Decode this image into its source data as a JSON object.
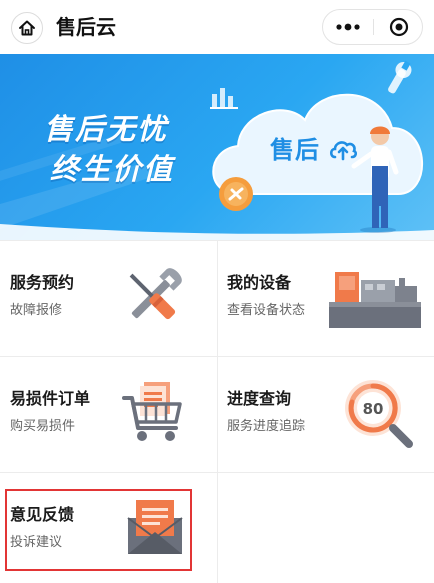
{
  "header": {
    "title": "售后云"
  },
  "banner": {
    "slogan_line1": "售后无忧",
    "slogan_line2": "终生价值",
    "cloud_brand": "售后"
  },
  "menu": [
    {
      "title": "服务预约",
      "subtitle": "故障报修",
      "icon": "tools-icon"
    },
    {
      "title": "我的设备",
      "subtitle": "查看设备状态",
      "icon": "machine-icon"
    },
    {
      "title": "易损件订单",
      "subtitle": "购买易损件",
      "icon": "cart-icon"
    },
    {
      "title": "进度查询",
      "subtitle": "服务进度追踪",
      "icon": "progress-magnifier-icon",
      "value": "80"
    },
    {
      "title": "意见反馈",
      "subtitle": "投诉建议",
      "icon": "envelope-icon"
    }
  ],
  "colors": {
    "banner": "#2aa7f2",
    "highlight": "#e23535",
    "accent_orange": "#f07a4a"
  }
}
